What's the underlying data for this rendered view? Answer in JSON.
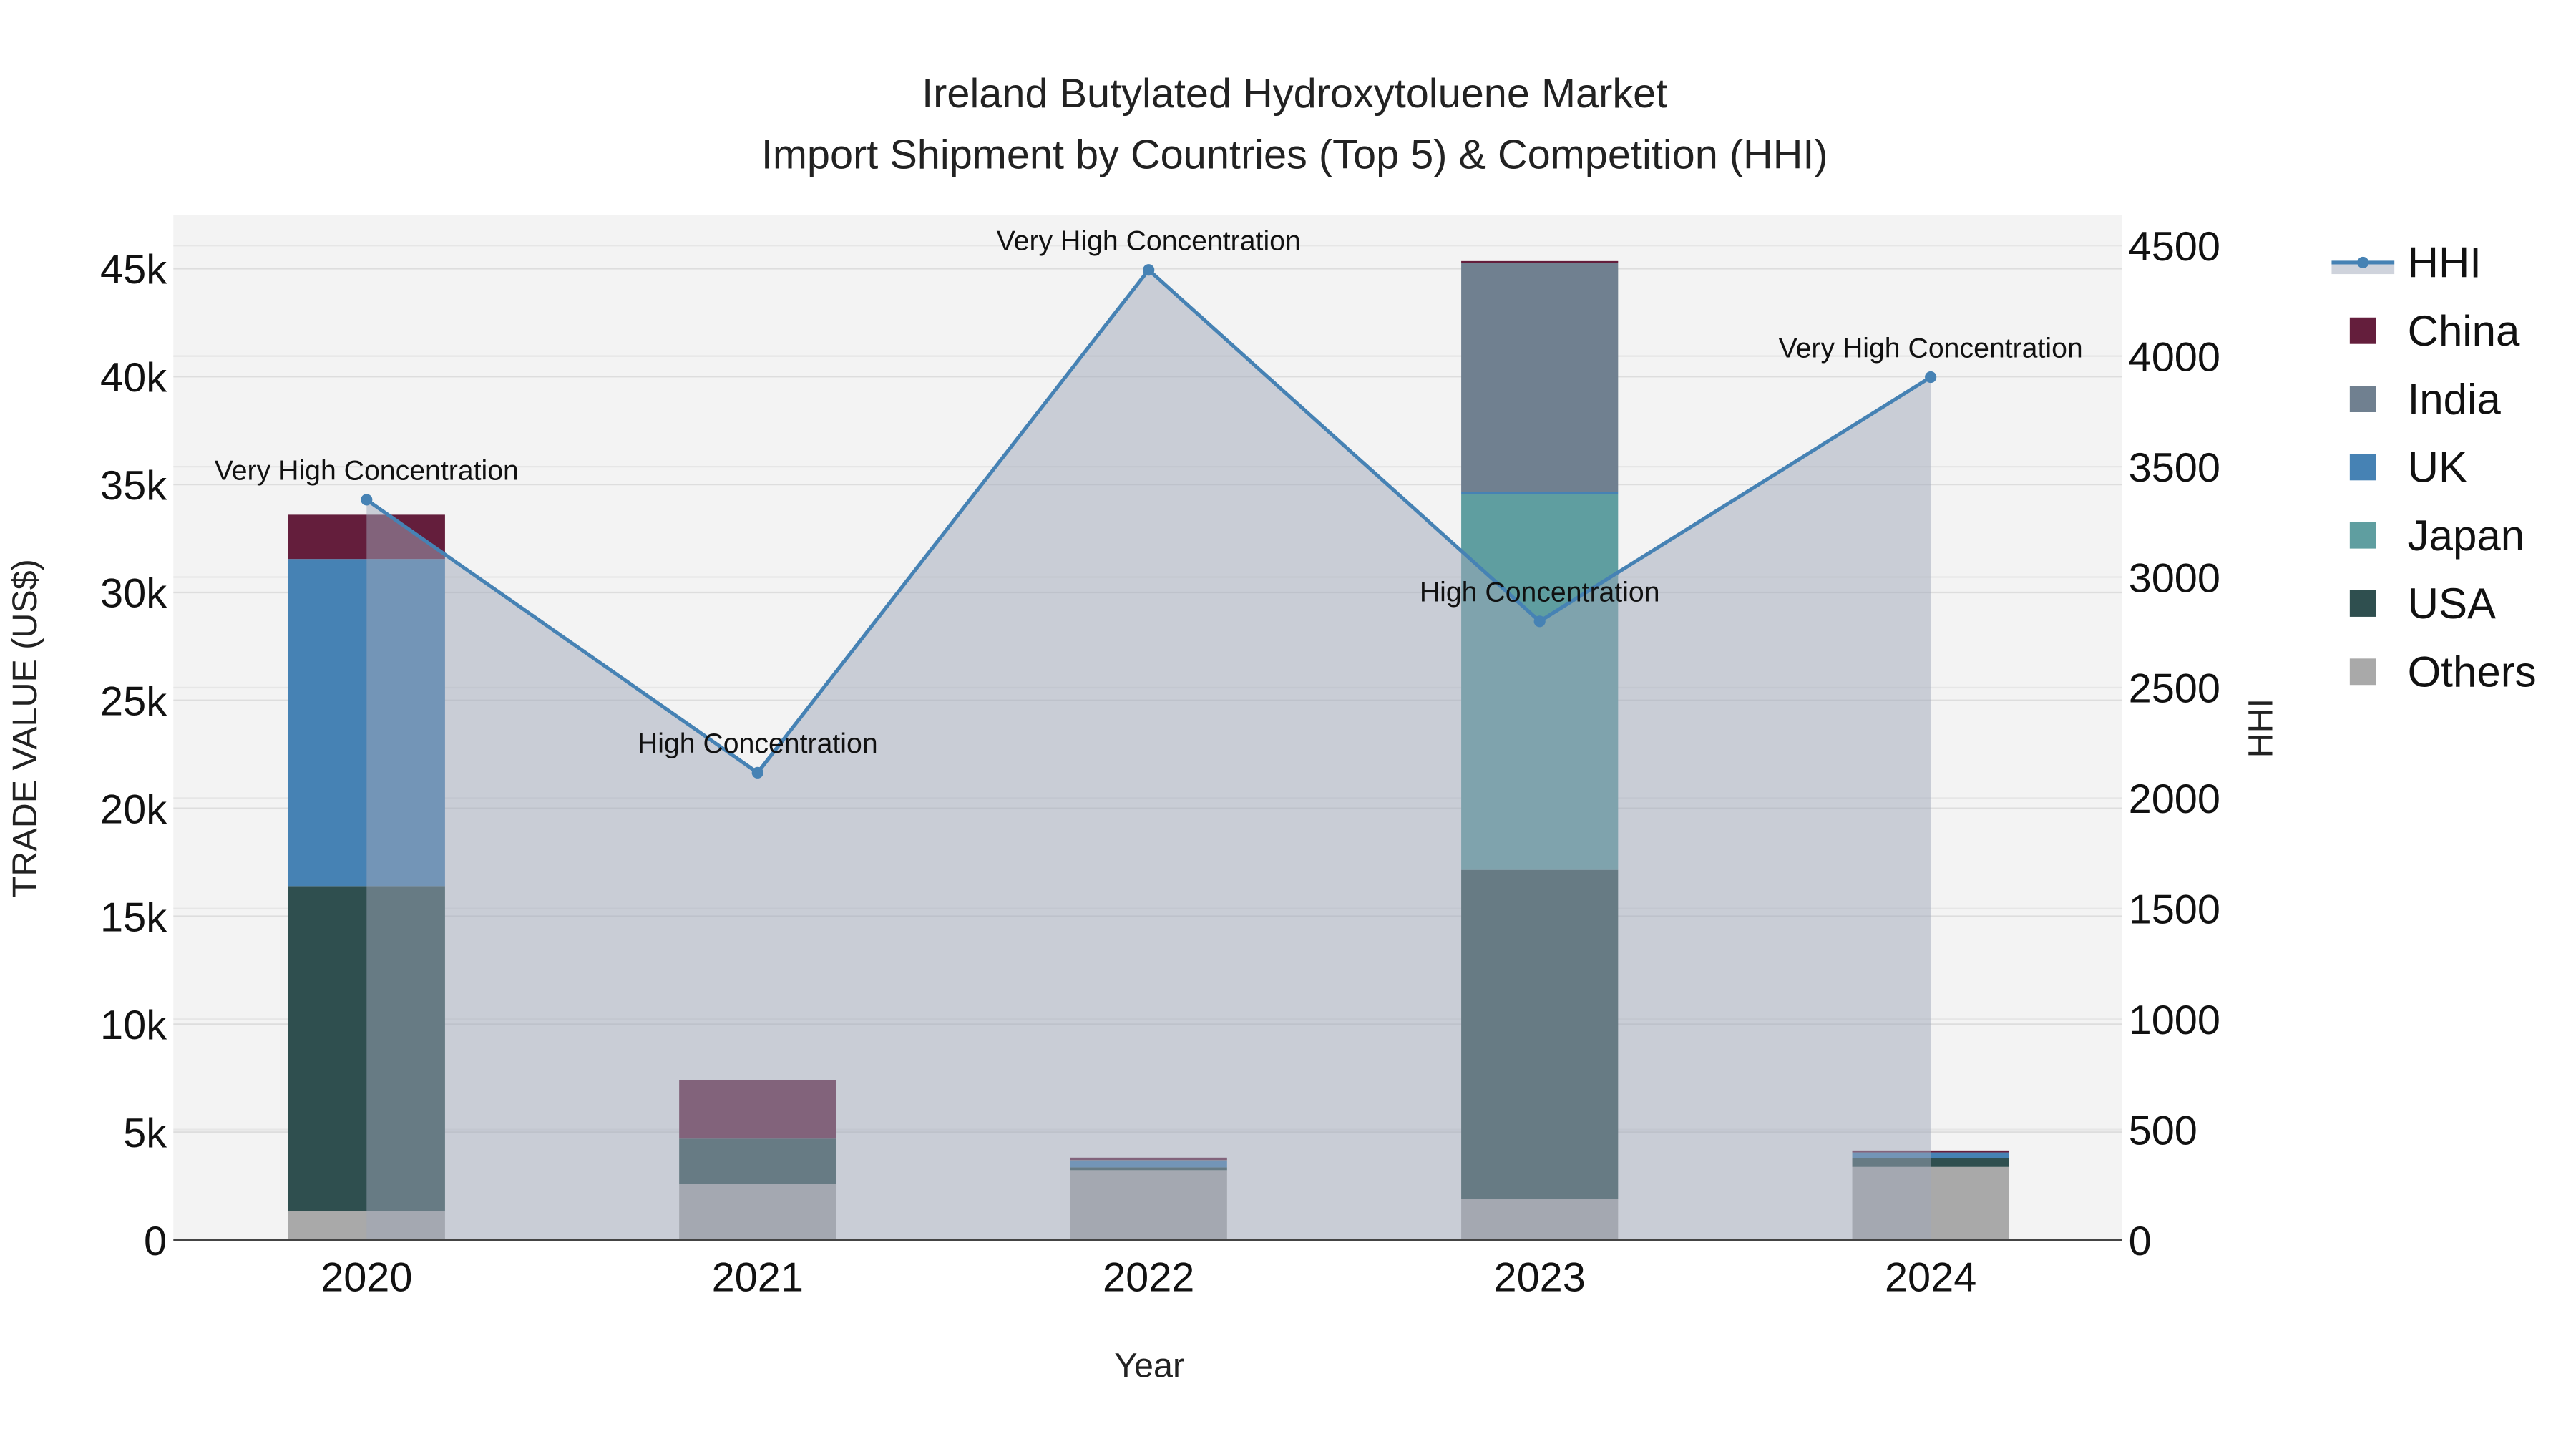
{
  "chart_data": {
    "type": "bar",
    "title": "Ireland Butylated Hydroxytoluene Market",
    "subtitle": "Import Shipment by Countries (Top 5) & Competition (HHI)",
    "xlabel": "Year",
    "ylabel": "TRADE VALUE (US$)",
    "y2label": "HHI",
    "categories": [
      "2020",
      "2021",
      "2022",
      "2023",
      "2024"
    ],
    "ylim": [
      0,
      47500
    ],
    "y2lim": [
      0,
      4640
    ],
    "yticks": [
      0,
      5000,
      10000,
      15000,
      20000,
      25000,
      30000,
      35000,
      40000,
      45000
    ],
    "ytick_labels": [
      "0",
      "5k",
      "10k",
      "15k",
      "20k",
      "25k",
      "30k",
      "35k",
      "40k",
      "45k"
    ],
    "y2ticks": [
      0,
      500,
      1000,
      1500,
      2000,
      2500,
      3000,
      3500,
      4000,
      4500
    ],
    "y2tick_labels": [
      "0",
      "500",
      "1000",
      "1500",
      "2000",
      "2500",
      "3000",
      "3500",
      "4000",
      "4500"
    ],
    "stacked": true,
    "series": [
      {
        "name": "Others",
        "color": "#a9a9a9",
        "values": [
          1350,
          2600,
          3240,
          1900,
          3390
        ]
      },
      {
        "name": "USA",
        "color": "#2f4f4f",
        "values": [
          15050,
          2100,
          130,
          15250,
          400
        ]
      },
      {
        "name": "Japan",
        "color": "#5f9ea0",
        "values": [
          0,
          0,
          0,
          17400,
          0
        ]
      },
      {
        "name": "UK",
        "color": "#4682b4",
        "values": [
          15150,
          0,
          310,
          100,
          270
        ]
      },
      {
        "name": "India",
        "color": "#708090",
        "values": [
          0,
          0,
          30,
          10600,
          0
        ]
      },
      {
        "name": "China",
        "color": "#641e3c",
        "values": [
          2050,
          2700,
          110,
          100,
          90
        ]
      }
    ],
    "hhi": {
      "name": "HHI",
      "color": "#4682b4",
      "values": [
        3350,
        2115,
        4390,
        2800,
        3905
      ],
      "annotations": [
        "Very High Concentration",
        "High Concentration",
        "Very High Concentration",
        "High Concentration",
        "Very High Concentration"
      ]
    },
    "legend": {
      "placement": "right",
      "entries": [
        "HHI",
        "China",
        "India",
        "UK",
        "Japan",
        "USA",
        "Others"
      ]
    },
    "grid": true
  }
}
